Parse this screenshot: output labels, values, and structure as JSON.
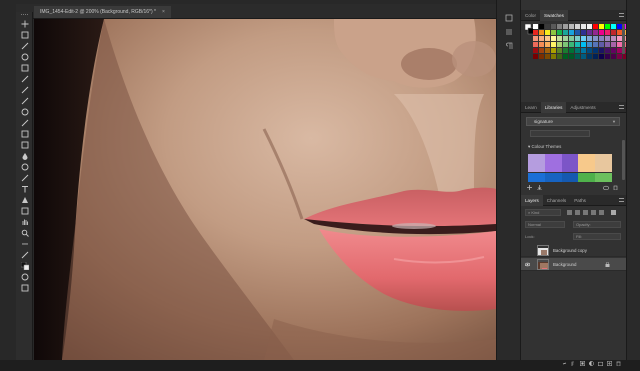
{
  "document": {
    "tab_title": "IMG_1454-Edit-2 @ 200% (Background, RGB/16*) *",
    "close_glyph": "×"
  },
  "toolbar": {
    "tools": [
      "move-tool-icon",
      "artboard-icon",
      "lasso-tool-icon",
      "quick-selection-icon",
      "crop-tool-icon",
      "eyedropper-icon",
      "healing-brush-icon",
      "brush-tool-icon",
      "clone-stamp-icon",
      "history-brush-icon",
      "eraser-icon",
      "gradient-icon",
      "blur-tool-icon",
      "dodge-tool-icon",
      "pen-tool-icon",
      "type-tool-icon",
      "path-selection-icon",
      "rectangle-tool-icon",
      "hand-tool-icon",
      "zoom-tool-icon",
      "more-tools-icon",
      "swap-colors-icon",
      "foreground-color-icon",
      "quick-mask-icon",
      "screen-mode-icon"
    ]
  },
  "swatches_panel": {
    "tabs": [
      {
        "label": "Color",
        "active": false
      },
      {
        "label": "Swatches",
        "active": true
      }
    ],
    "colors": [
      "#ffffff",
      "#000000",
      "#3a3a3a",
      "#595959",
      "#7f7f7f",
      "#9e9e9e",
      "#b8b8b8",
      "#d2d2d2",
      "#e6e6e6",
      "#f2f2f2",
      "#ff0000",
      "#ffff00",
      "#00ff00",
      "#00ffff",
      "#0000ff",
      "#ff00ff",
      "#e8261f",
      "#f3931c",
      "#f8ec1e",
      "#8dc641",
      "#1ab24b",
      "#19a69a",
      "#1aa3dc",
      "#1e58a8",
      "#2e3192",
      "#662d91",
      "#92278f",
      "#ec008c",
      "#ed1c6d",
      "#c1272d",
      "#f05a28",
      "#fbb03b",
      "#f7977a",
      "#f9ad81",
      "#fdc68a",
      "#fff79a",
      "#c4df9b",
      "#a2d39c",
      "#82ca9d",
      "#7bcdc8",
      "#6ecff6",
      "#7ea7d8",
      "#8493ca",
      "#8882be",
      "#a187be",
      "#bc8dbf",
      "#f49ac2",
      "#f6989d",
      "#ed6a5a",
      "#f68e56",
      "#fbaf5d",
      "#fff467",
      "#acd372",
      "#7cc576",
      "#3bb878",
      "#1abbb4",
      "#00bff3",
      "#438ccb",
      "#5574b9",
      "#605ca8",
      "#8560a8",
      "#a864a8",
      "#f06eaa",
      "#f26d7d",
      "#9e0b0f",
      "#a0410d",
      "#a3620a",
      "#aba000",
      "#598527",
      "#1a7b30",
      "#007236",
      "#00746b",
      "#0076a3",
      "#004b80",
      "#003471",
      "#1b1464",
      "#440e62",
      "#630460",
      "#9e005d",
      "#9e0039",
      "#790000",
      "#7b2e00",
      "#7d4900",
      "#827b00",
      "#406618",
      "#005e20",
      "#005826",
      "#005952",
      "#005b7f",
      "#003663",
      "#002157",
      "#0d004c",
      "#32004b",
      "#4b0049",
      "#7b0046",
      "#7a0026"
    ]
  },
  "libraries_panel": {
    "tabs": [
      {
        "label": "Learn",
        "active": false
      },
      {
        "label": "Libraries",
        "active": true
      },
      {
        "label": "Adjustments",
        "active": false
      }
    ],
    "library_name": "signature",
    "section_label": "Colour Themes",
    "theme_colors_top": [
      "#b59ddf",
      "#9f6fe0",
      "#7c55c7",
      "#f7c98b",
      "#e8c79e"
    ],
    "theme_colors_bottom": [
      "#1b6fd6",
      "#1763c1",
      "#1559b0",
      "#4fb14b",
      "#6cc05e"
    ]
  },
  "layers_panel": {
    "tabs": [
      {
        "label": "Layers",
        "active": true
      },
      {
        "label": "Channels",
        "active": false
      },
      {
        "label": "Paths",
        "active": false
      }
    ],
    "filter_label": "Kind",
    "blend_mode": "Normal",
    "opacity_label": "Opacity:",
    "lock_label": "Lock:",
    "fill_label": "Fill:",
    "layers": [
      {
        "name": "Background copy",
        "visible": false,
        "selected": false
      },
      {
        "name": "Background",
        "visible": true,
        "selected": true
      }
    ],
    "footer_icons": [
      "link-layers-icon",
      "fx-icon",
      "mask-icon",
      "adjustment-icon",
      "group-icon",
      "new-layer-icon",
      "delete-layer-icon"
    ]
  },
  "colors": {
    "app_bg": "#282828",
    "panel_bg": "#323232",
    "selected_row": "#4a4a4a",
    "lip_color": "#e9777a"
  }
}
